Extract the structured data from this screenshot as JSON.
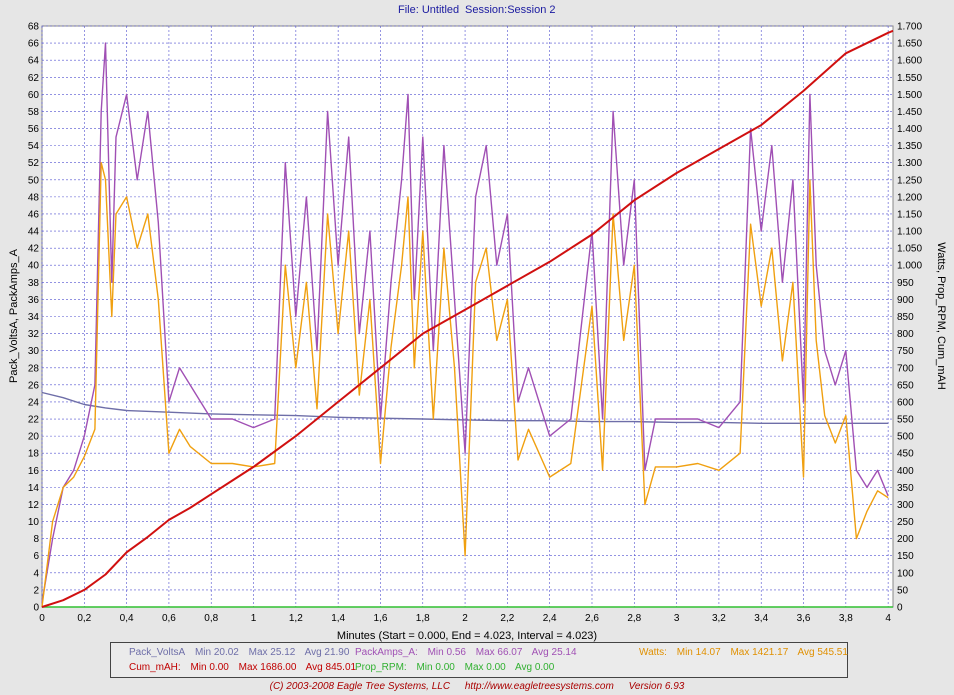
{
  "header": {
    "file": "File: Untitled",
    "session": "Session:Session 2"
  },
  "chart_data": {
    "type": "line",
    "xlabel": "Minutes (Start = 0.000,  End = 4.023,  Interval =  4.023)",
    "ylabel_left": "Pack_VoltsA, PackAmps_A",
    "ylabel_right": "Watts, Prop_RPM, Cum_mAH",
    "xlim": [
      0,
      4.023
    ],
    "ylim_left": [
      0,
      68
    ],
    "ylim_right": [
      0,
      1700
    ],
    "x_ticks": [
      "0",
      "0,2",
      "0,4",
      "0,6",
      "0,8",
      "1",
      "1,2",
      "1,4",
      "1,6",
      "1,8",
      "2",
      "2,2",
      "2,4",
      "2,6",
      "2,8",
      "3",
      "3,2",
      "3,4",
      "3,6",
      "3,8",
      "4"
    ],
    "y_left_ticks": [
      "0",
      "2",
      "4",
      "6",
      "8",
      "10",
      "12",
      "14",
      "16",
      "18",
      "20",
      "22",
      "24",
      "26",
      "28",
      "30",
      "32",
      "34",
      "36",
      "38",
      "40",
      "42",
      "44",
      "46",
      "48",
      "50",
      "52",
      "54",
      "56",
      "58",
      "60",
      "62",
      "64",
      "66",
      "68"
    ],
    "y_right_ticks": [
      "0",
      "50",
      "100",
      "150",
      "200",
      "250",
      "300",
      "350",
      "400",
      "450",
      "500",
      "550",
      "600",
      "650",
      "700",
      "750",
      "800",
      "850",
      "900",
      "950",
      "1.000",
      "1.050",
      "1.100",
      "1.150",
      "1.200",
      "1.250",
      "1.300",
      "1.350",
      "1.400",
      "1.450",
      "1.500",
      "1.550",
      "1.600",
      "1.650",
      "1.700"
    ],
    "grid": true,
    "series": [
      {
        "name": "Pack_VoltsA",
        "axis": "left",
        "color": "#6e6ea8",
        "x": [
          0,
          0.1,
          0.2,
          0.3,
          0.4,
          0.6,
          0.8,
          1.0,
          1.2,
          1.4,
          1.6,
          1.8,
          2.0,
          2.2,
          2.4,
          2.6,
          2.8,
          3.0,
          3.2,
          3.4,
          3.6,
          3.8,
          4.0
        ],
        "y": [
          25.1,
          24.5,
          23.7,
          23.3,
          23.0,
          22.8,
          22.6,
          22.5,
          22.4,
          22.2,
          22.1,
          22.0,
          21.9,
          21.8,
          21.8,
          21.7,
          21.7,
          21.6,
          21.6,
          21.5,
          21.5,
          21.5,
          21.5
        ]
      },
      {
        "name": "PackAmps_A",
        "axis": "left",
        "color": "#a050b4",
        "x": [
          0,
          0.05,
          0.1,
          0.15,
          0.2,
          0.25,
          0.28,
          0.3,
          0.33,
          0.35,
          0.4,
          0.45,
          0.5,
          0.55,
          0.6,
          0.65,
          0.7,
          0.8,
          0.9,
          1.0,
          1.1,
          1.15,
          1.2,
          1.25,
          1.3,
          1.35,
          1.4,
          1.45,
          1.5,
          1.55,
          1.6,
          1.65,
          1.7,
          1.73,
          1.76,
          1.8,
          1.85,
          1.9,
          1.95,
          2.0,
          2.05,
          2.1,
          2.15,
          2.2,
          2.25,
          2.3,
          2.4,
          2.5,
          2.6,
          2.65,
          2.7,
          2.75,
          2.8,
          2.85,
          2.9,
          3.0,
          3.1,
          3.2,
          3.3,
          3.35,
          3.4,
          3.45,
          3.5,
          3.55,
          3.6,
          3.63,
          3.66,
          3.7,
          3.75,
          3.8,
          3.85,
          3.9,
          3.95,
          4.0
        ],
        "y": [
          0.5,
          8,
          14,
          16,
          20,
          26,
          58,
          66,
          38,
          55,
          60,
          50,
          58,
          45,
          24,
          28,
          26,
          22,
          22,
          21,
          22,
          52,
          34,
          48,
          30,
          58,
          40,
          55,
          32,
          44,
          22,
          38,
          50,
          60,
          36,
          55,
          30,
          54,
          36,
          18,
          48,
          54,
          40,
          46,
          24,
          28,
          20,
          22,
          44,
          22,
          58,
          40,
          50,
          16,
          22,
          22,
          22,
          21,
          24,
          56,
          44,
          54,
          38,
          50,
          24,
          60,
          40,
          30,
          26,
          30,
          16,
          14,
          16,
          13
        ]
      },
      {
        "name": "Watts",
        "axis": "right",
        "color": "#f0a010",
        "x": [
          0,
          0.05,
          0.1,
          0.15,
          0.2,
          0.25,
          0.28,
          0.3,
          0.33,
          0.35,
          0.4,
          0.45,
          0.5,
          0.55,
          0.6,
          0.65,
          0.7,
          0.8,
          0.9,
          1.0,
          1.1,
          1.15,
          1.2,
          1.25,
          1.3,
          1.35,
          1.4,
          1.45,
          1.5,
          1.55,
          1.6,
          1.65,
          1.7,
          1.73,
          1.76,
          1.8,
          1.85,
          1.9,
          1.95,
          2.0,
          2.05,
          2.1,
          2.15,
          2.2,
          2.25,
          2.3,
          2.4,
          2.5,
          2.6,
          2.65,
          2.7,
          2.75,
          2.8,
          2.85,
          2.9,
          3.0,
          3.1,
          3.2,
          3.3,
          3.35,
          3.4,
          3.45,
          3.5,
          3.55,
          3.6,
          3.63,
          3.66,
          3.7,
          3.75,
          3.8,
          3.85,
          3.9,
          3.95,
          4.0
        ],
        "y": [
          0,
          250,
          350,
          380,
          440,
          520,
          1300,
          1250,
          850,
          1150,
          1200,
          1050,
          1150,
          900,
          450,
          520,
          470,
          420,
          420,
          410,
          420,
          1000,
          700,
          950,
          580,
          1150,
          800,
          1100,
          620,
          900,
          420,
          760,
          1000,
          1200,
          700,
          1100,
          550,
          1050,
          700,
          150,
          950,
          1050,
          780,
          900,
          430,
          520,
          380,
          420,
          880,
          400,
          1150,
          780,
          1000,
          300,
          410,
          410,
          420,
          400,
          450,
          1120,
          880,
          1050,
          720,
          950,
          380,
          1250,
          780,
          560,
          480,
          560,
          200,
          280,
          340,
          320
        ]
      },
      {
        "name": "Cum_mAH",
        "axis": "right",
        "color": "#d01010",
        "x": [
          0,
          0.1,
          0.2,
          0.3,
          0.4,
          0.5,
          0.6,
          0.7,
          0.8,
          0.9,
          1.0,
          1.2,
          1.4,
          1.6,
          1.8,
          2.0,
          2.2,
          2.4,
          2.6,
          2.8,
          3.0,
          3.2,
          3.4,
          3.6,
          3.8,
          4.0,
          4.023
        ],
        "y": [
          0,
          20,
          50,
          95,
          160,
          205,
          255,
          290,
          330,
          370,
          410,
          500,
          600,
          700,
          800,
          870,
          940,
          1010,
          1090,
          1190,
          1270,
          1340,
          1410,
          1510,
          1620,
          1680,
          1686
        ]
      },
      {
        "name": "Prop_RPM",
        "axis": "right",
        "color": "#30c030",
        "x": [
          0,
          4.023
        ],
        "y": [
          0,
          0
        ]
      }
    ]
  },
  "legend": {
    "row1": [
      {
        "name": "Pack_VoltsA",
        "color": "#6e6ea8",
        "min": "Min 20.02",
        "max": "Max 25.12",
        "avg": "Avg 21.90"
      },
      {
        "name": "PackAmps_A:",
        "color": "#a050b4",
        "min": "Min 0.56",
        "max": "Max 66.07",
        "avg": "Avg 25.14"
      },
      {
        "name": "Watts:",
        "color": "#e09000",
        "min": "Min 14.07",
        "max": "Max 1421.17",
        "avg": "Avg 545.51"
      }
    ],
    "row2": [
      {
        "name": "Cum_mAH:",
        "color": "#c00000",
        "min": "Min 0.00",
        "max": "Max 1686.00",
        "avg": "Avg 845.01"
      },
      {
        "name": "Prop_RPM:",
        "color": "#30b030",
        "min": "Min 0.00",
        "max": "Max 0.00",
        "avg": "Avg 0.00"
      }
    ]
  },
  "footer": {
    "copyright": "(C) 2003-2008 Eagle Tree Systems, LLC",
    "url": "http://www.eagletreesystems.com",
    "version": "Version 6.93"
  }
}
